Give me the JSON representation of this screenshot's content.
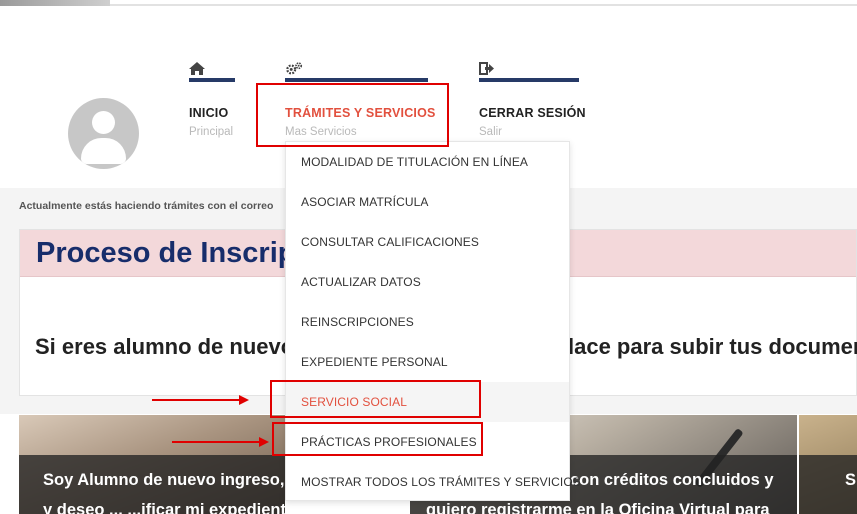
{
  "nav": {
    "inicio": {
      "title": "INICIO",
      "sub": "Principal",
      "icon": "home-icon"
    },
    "tramites": {
      "title": "TRÁMITES Y SERVICIOS",
      "sub": "Mas Servicios",
      "icon": "gears-icon"
    },
    "cerrar": {
      "title": "CERRAR SESIÓN",
      "sub": "Salir",
      "icon": "sign-out-icon"
    }
  },
  "notice": "Actualmente estás haciendo trámites con el correo",
  "process": {
    "title": "Proceso de Inscripción",
    "text_left": "Si eres alumno de nuevo",
    "text_right": "lace para subir tus documentos"
  },
  "tiles": [
    {
      "line1": "Soy Alumno de nuevo ingreso,",
      "line2": "y deseo ... ...ificar mi expediente o"
    },
    {
      "line1": "con créditos concluidos y",
      "line2": "quiero registrarme en la Oficina Virtual para"
    },
    {
      "line1": "S"
    }
  ],
  "dropdown": {
    "items": [
      "MODALIDAD DE TITULACIÓN EN LÍNEA",
      "ASOCIAR MATRÍCULA",
      "CONSULTAR CALIFICACIONES",
      "ACTUALIZAR DATOS",
      "REINSCRIPCIONES",
      "EXPEDIENTE PERSONAL",
      "SERVICIO SOCIAL",
      "PRÁCTICAS PROFESIONALES",
      "MOSTRAR TODOS LOS TRÁMITES Y SERVICIOS"
    ],
    "hover_index": 6
  },
  "colors": {
    "accent_red": "#e2503e",
    "nav_bar": "#263a67",
    "title_blue": "#172d6b",
    "annotation_red": "#e00000"
  }
}
